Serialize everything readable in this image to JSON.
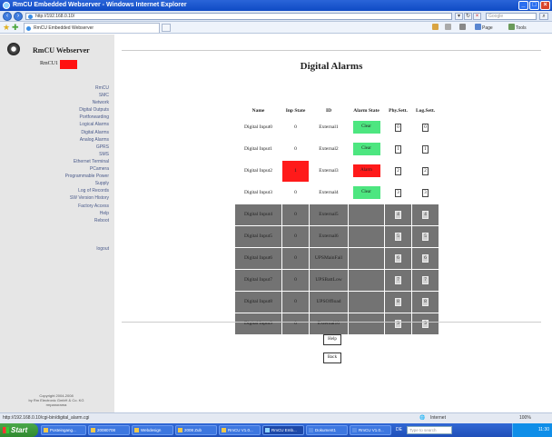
{
  "window": {
    "title": "RmCU Embedded Webserver - Windows Internet Explorer"
  },
  "address": {
    "url": "http://192.168.0.10/",
    "search_placeholder": "Google"
  },
  "tab": {
    "title": "RmCU Embedded Webserver"
  },
  "commands": {
    "page": "Page",
    "tools": "Tools"
  },
  "sidebar": {
    "title": "RmCU Webserver",
    "device": "RmCU1",
    "links": [
      "RmCU",
      "SMC",
      "Network",
      "Digital Outputs",
      "Portforwarding",
      "Logical Alarms",
      "Digital Alarms",
      "Analog Alarms",
      "GPRS",
      "SMS",
      "Ethernet Terminal",
      "PCamera",
      "Programmable Power",
      "Supply",
      "Log of Records",
      "SW Version History",
      "Factory Access",
      "Help",
      "Reboot"
    ],
    "logout": "logout",
    "copyright": [
      "Copyright 2004-2008",
      "by Rm Electronic GmbH & Co. KG",
      "rmpanorama"
    ]
  },
  "page": {
    "title": "Digital Alarms",
    "columns": [
      "Name",
      "Inp State",
      "ID",
      "Alarm State",
      "Phy.Sett.",
      "Log.Sett."
    ],
    "rows": [
      {
        "name": "Digital Input0",
        "state": "0",
        "id": "External1",
        "alarm": "Clear",
        "phy": "0",
        "log": "0"
      },
      {
        "name": "Digital Input1",
        "state": "0",
        "id": "External2",
        "alarm": "Clear",
        "phy": "1",
        "log": "1"
      },
      {
        "name": "Digital Input2",
        "state": "1",
        "id": "External3",
        "alarm": "Alarm",
        "phy": "2",
        "log": "2"
      },
      {
        "name": "Digital Input3",
        "state": "0",
        "id": "External4",
        "alarm": "Clear",
        "phy": "3",
        "log": "3"
      },
      {
        "name": "Digital Input4",
        "state": "0",
        "id": "External5",
        "alarm": "",
        "phy": "4",
        "log": "4"
      },
      {
        "name": "Digital Input5",
        "state": "0",
        "id": "External6",
        "alarm": "",
        "phy": "5",
        "log": "5"
      },
      {
        "name": "Digital Input6",
        "state": "0",
        "id": "UPSMainFail",
        "alarm": "",
        "phy": "6",
        "log": "6"
      },
      {
        "name": "Digital Input7",
        "state": "0",
        "id": "UPSBattLow",
        "alarm": "",
        "phy": "7",
        "log": "7"
      },
      {
        "name": "Digital Input8",
        "state": "0",
        "id": "UPSOffload",
        "alarm": "",
        "phy": "8",
        "log": "8"
      },
      {
        "name": "Digital Input9",
        "state": "0",
        "id": "External10",
        "alarm": "",
        "phy": "9",
        "log": "9"
      }
    ],
    "help_label": "Help",
    "back_label": "Back"
  },
  "status": {
    "url": "http://192.168.0.10/cgi-bin/digital_alarm.cgi",
    "zone": "Internet",
    "zoom": "100%"
  },
  "taskbar": {
    "start": "Start",
    "tasks": [
      "Posteingang...",
      "20080708",
      "Webdesign",
      "2008 Zub",
      "RmCU V1.0...",
      "RmCU Emb...",
      "Dokument1",
      "RmCU V1.0..."
    ],
    "lang": "DE",
    "search": "Type to search",
    "clock": "11:30"
  },
  "colors": {
    "clear": "#4de680",
    "alarm": "#ff1a1a",
    "sidebar": "#e6e6e6",
    "dark_row": "#737373"
  }
}
